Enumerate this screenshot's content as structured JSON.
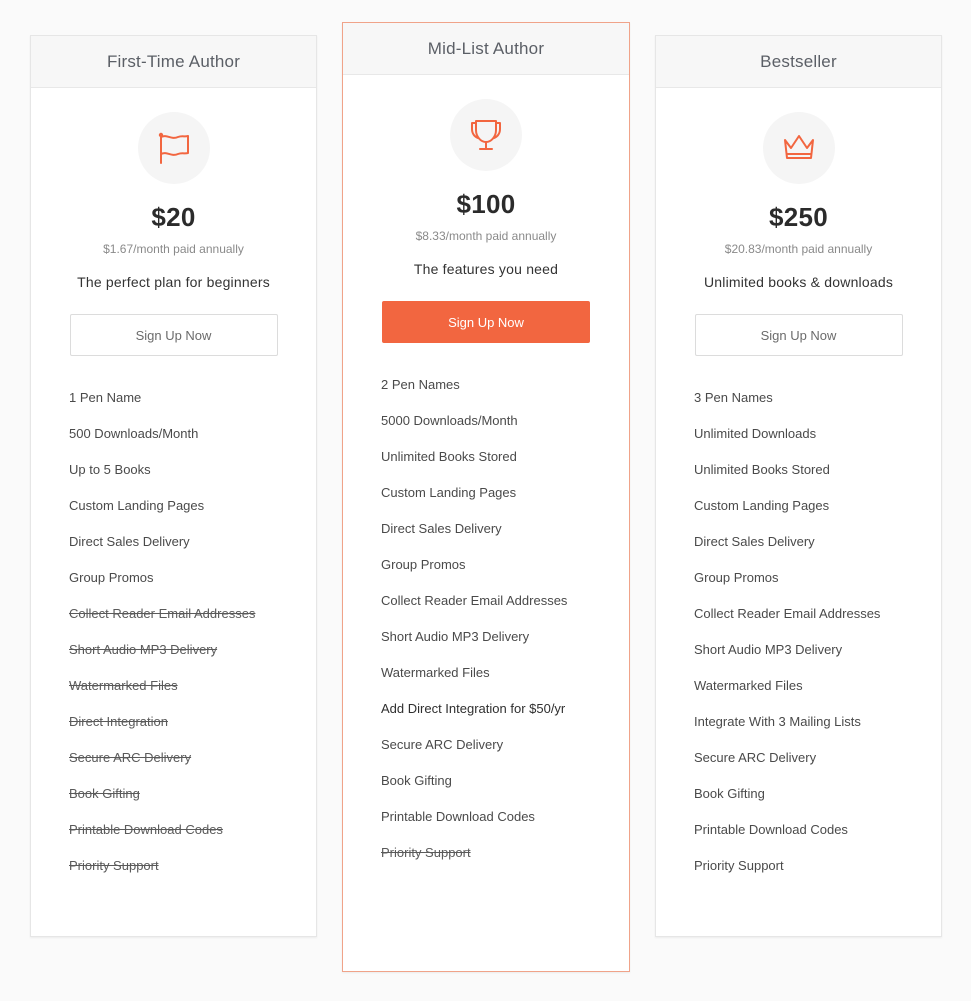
{
  "accent_color": "#f26640",
  "plans": [
    {
      "name": "First-Time Author",
      "icon": "flag-icon",
      "price": "$20",
      "per_month": "$1.67/month paid annually",
      "tagline": "The perfect plan for beginners",
      "cta": "Sign Up Now",
      "cta_style": "outline",
      "highlighted": false,
      "features": [
        {
          "text": "1 Pen Name",
          "included": true
        },
        {
          "text": "500 Downloads/Month",
          "included": true
        },
        {
          "text": "Up to 5 Books",
          "included": true
        },
        {
          "text": "Custom Landing Pages",
          "included": true
        },
        {
          "text": "Direct Sales Delivery",
          "included": true
        },
        {
          "text": "Group Promos",
          "included": true
        },
        {
          "text": "Collect Reader Email Addresses",
          "included": false
        },
        {
          "text": "Short Audio MP3 Delivery",
          "included": false
        },
        {
          "text": "Watermarked Files",
          "included": false
        },
        {
          "text": "Direct Integration",
          "included": false
        },
        {
          "text": "Secure ARC Delivery",
          "included": false
        },
        {
          "text": "Book Gifting",
          "included": false
        },
        {
          "text": "Printable Download Codes",
          "included": false
        },
        {
          "text": "Priority Support",
          "included": false
        }
      ]
    },
    {
      "name": "Mid-List Author",
      "icon": "trophy-icon",
      "price": "$100",
      "per_month": "$8.33/month paid annually",
      "tagline": "The features you need",
      "cta": "Sign Up Now",
      "cta_style": "primary",
      "highlighted": true,
      "features": [
        {
          "text": "2 Pen Names",
          "included": true
        },
        {
          "text": "5000 Downloads/Month",
          "included": true
        },
        {
          "text": "Unlimited Books Stored",
          "included": true
        },
        {
          "text": "Custom Landing Pages",
          "included": true
        },
        {
          "text": "Direct Sales Delivery",
          "included": true
        },
        {
          "text": "Group Promos",
          "included": true
        },
        {
          "text": "Collect Reader Email Addresses",
          "included": true
        },
        {
          "text": "Short Audio MP3 Delivery",
          "included": true
        },
        {
          "text": "Watermarked Files",
          "included": true
        },
        {
          "text": "Add Direct Integration for $50/yr",
          "included": true,
          "emphasis": true
        },
        {
          "text": "Secure ARC Delivery",
          "included": true
        },
        {
          "text": "Book Gifting",
          "included": true
        },
        {
          "text": "Printable Download Codes",
          "included": true
        },
        {
          "text": "Priority Support",
          "included": false
        }
      ]
    },
    {
      "name": "Bestseller",
      "icon": "crown-icon",
      "price": "$250",
      "per_month": "$20.83/month paid annually",
      "tagline": "Unlimited books & downloads",
      "cta": "Sign Up Now",
      "cta_style": "outline",
      "highlighted": false,
      "features": [
        {
          "text": "3 Pen Names",
          "included": true
        },
        {
          "text": "Unlimited Downloads",
          "included": true
        },
        {
          "text": "Unlimited Books Stored",
          "included": true
        },
        {
          "text": "Custom Landing Pages",
          "included": true
        },
        {
          "text": "Direct Sales Delivery",
          "included": true
        },
        {
          "text": "Group Promos",
          "included": true
        },
        {
          "text": "Collect Reader Email Addresses",
          "included": true
        },
        {
          "text": "Short Audio MP3 Delivery",
          "included": true
        },
        {
          "text": "Watermarked Files",
          "included": true
        },
        {
          "text": "Integrate With 3 Mailing Lists",
          "included": true
        },
        {
          "text": "Secure ARC Delivery",
          "included": true
        },
        {
          "text": "Book Gifting",
          "included": true
        },
        {
          "text": "Printable Download Codes",
          "included": true
        },
        {
          "text": "Priority Support",
          "included": true
        }
      ]
    }
  ]
}
